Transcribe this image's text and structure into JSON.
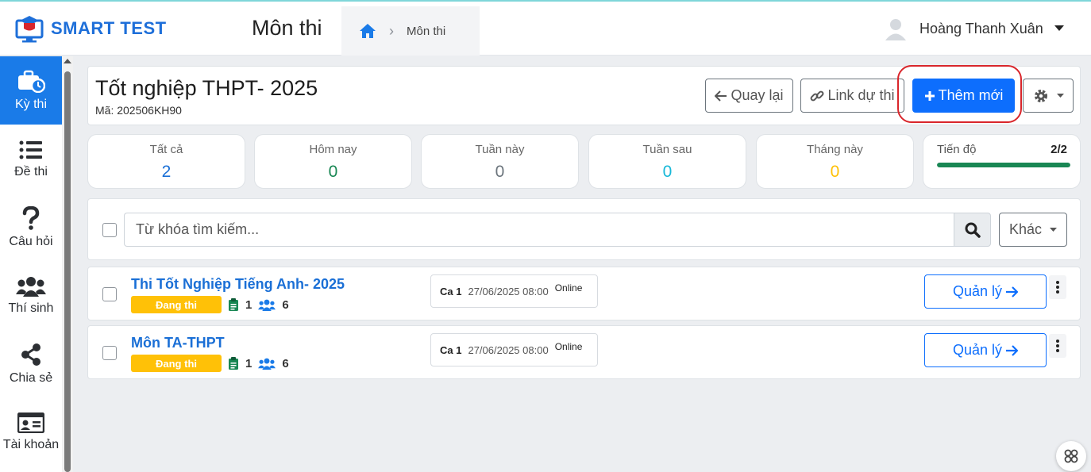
{
  "app": {
    "brand": "SMART TEST",
    "page_title": "Môn thi"
  },
  "breadcrumb": {
    "current": "Môn thi"
  },
  "user": {
    "name": "Hoàng Thanh Xuân"
  },
  "sidebar": {
    "items": [
      {
        "label": "Kỳ thi",
        "icon": "briefcase-clock-icon",
        "active": true
      },
      {
        "label": "Đề thi",
        "icon": "list-icon",
        "active": false
      },
      {
        "label": "Câu hỏi",
        "icon": "question-icon",
        "active": false
      },
      {
        "label": "Thí sinh",
        "icon": "users-icon",
        "active": false
      },
      {
        "label": "Chia sẻ",
        "icon": "share-icon",
        "active": false
      },
      {
        "label": "Tài khoản",
        "icon": "id-card-icon",
        "active": false
      }
    ]
  },
  "exam": {
    "title": "Tốt nghiệp THPT- 2025",
    "code": "Mã: 202506KH90",
    "back_label": "Quay lại",
    "link_label": "Link dự thi",
    "add_label": "Thêm mới"
  },
  "stats": [
    {
      "label": "Tất cả",
      "value": "2",
      "color": "#1a6fd6"
    },
    {
      "label": "Hôm nay",
      "value": "0",
      "color": "#198754"
    },
    {
      "label": "Tuần này",
      "value": "0",
      "color": "#6c757d"
    },
    {
      "label": "Tuần sau",
      "value": "0",
      "color": "#17b8d8"
    },
    {
      "label": "Tháng này",
      "value": "0",
      "color": "#ffc107"
    }
  ],
  "progress": {
    "label": "Tiến độ",
    "count": "2/2",
    "fraction": 1.0,
    "color": "#198754"
  },
  "search": {
    "placeholder": "Từ khóa tìm kiếm...",
    "other_label": "Khác"
  },
  "subjects": [
    {
      "title": "Thi Tốt Nghiệp Tiếng Anh- 2025",
      "status": "Đang thi",
      "papers": "1",
      "candidates": "6",
      "session": "Ca 1",
      "time": "27/06/2025 08:00",
      "mode": "Online",
      "manage_label": "Quản lý"
    },
    {
      "title": "Môn TA-THPT",
      "status": "Đang thi",
      "papers": "1",
      "candidates": "6",
      "session": "Ca 1",
      "time": "27/06/2025 08:00",
      "mode": "Online",
      "manage_label": "Quản lý"
    }
  ]
}
